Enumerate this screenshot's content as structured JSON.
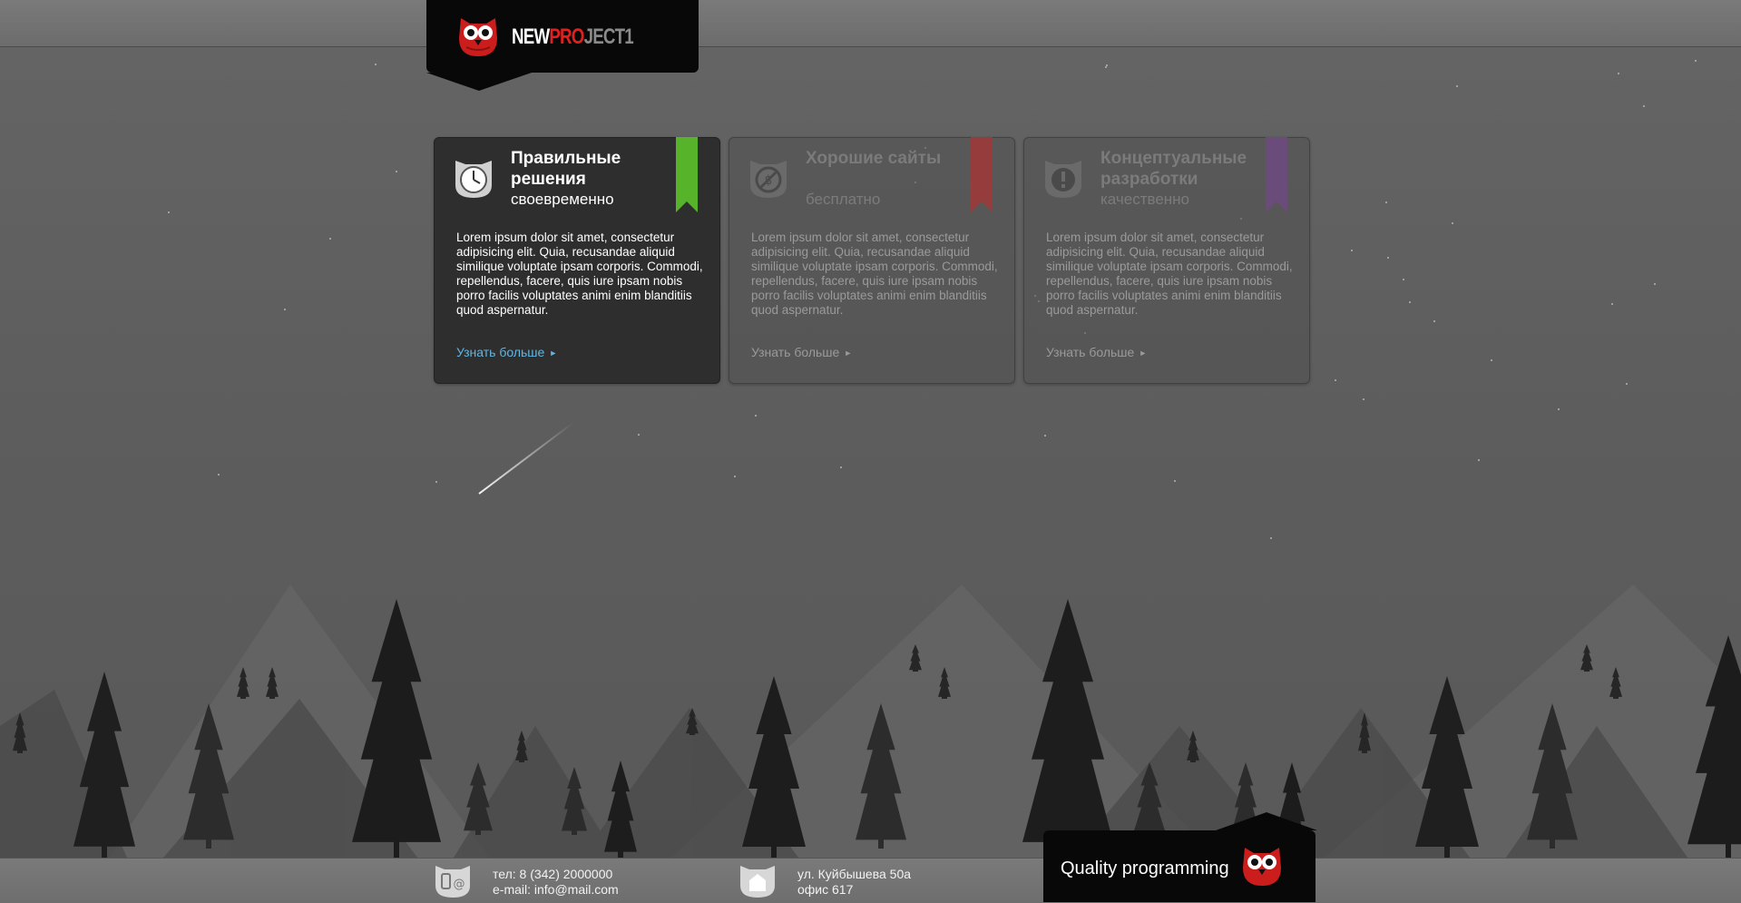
{
  "brand": {
    "logo_new": "NEW",
    "logo_pro": "PRO",
    "logo_ject": "JECT",
    "logo_num": "1",
    "owl_icon": "owl-logo-icon",
    "accent_red": "#cc1d1d"
  },
  "features": [
    {
      "title": "Правильные решения",
      "subtitle": "своевременно",
      "text": "Lorem ipsum dolor sit amet, consectetur adipisicing elit. Quia, recusandae aliquid similique voluptate ipsam corporis. Commodi, repellendus, facere, quis iure ipsam nobis porro facilis voluptates animi enim blanditiis quod aspernatur.",
      "more": "Узнать больше",
      "icon": "clock-icon",
      "ribbon_color": "#56b32a",
      "active": true
    },
    {
      "title": "Хорошие сайты",
      "subtitle": "бесплатно",
      "text": "Lorem ipsum dolor sit amet, consectetur adipisicing elit. Quia, recusandae aliquid similique voluptate ipsam corporis. Commodi, repellendus, facere, quis iure ipsam nobis porro facilis voluptates animi enim blanditiis quod aspernatur.",
      "more": "Узнать больше",
      "icon": "no-money-icon",
      "ribbon_color": "#963c3c",
      "active": false
    },
    {
      "title": "Концептуальные разработки",
      "subtitle": "качественно",
      "text": "Lorem ipsum dolor sit amet, consectetur adipisicing elit. Quia, recusandae aliquid similique voluptate ipsam corporis. Commodi, repellendus, facere, quis iure ipsam nobis porro facilis voluptates animi enim blanditiis quod aspernatur.",
      "more": "Узнать больше",
      "icon": "exclamation-icon",
      "ribbon_color": "#6a4b7a",
      "active": false
    }
  ],
  "footer": {
    "phone": "тел: 8 (342) 2000000",
    "email": "e-mail: info@mail.com",
    "address": "ул. Куйбышева 50а",
    "office": "офис 617",
    "phone_icon": "phone-email-icon",
    "address_icon": "home-icon"
  },
  "badge": {
    "text": "Quality programming"
  }
}
